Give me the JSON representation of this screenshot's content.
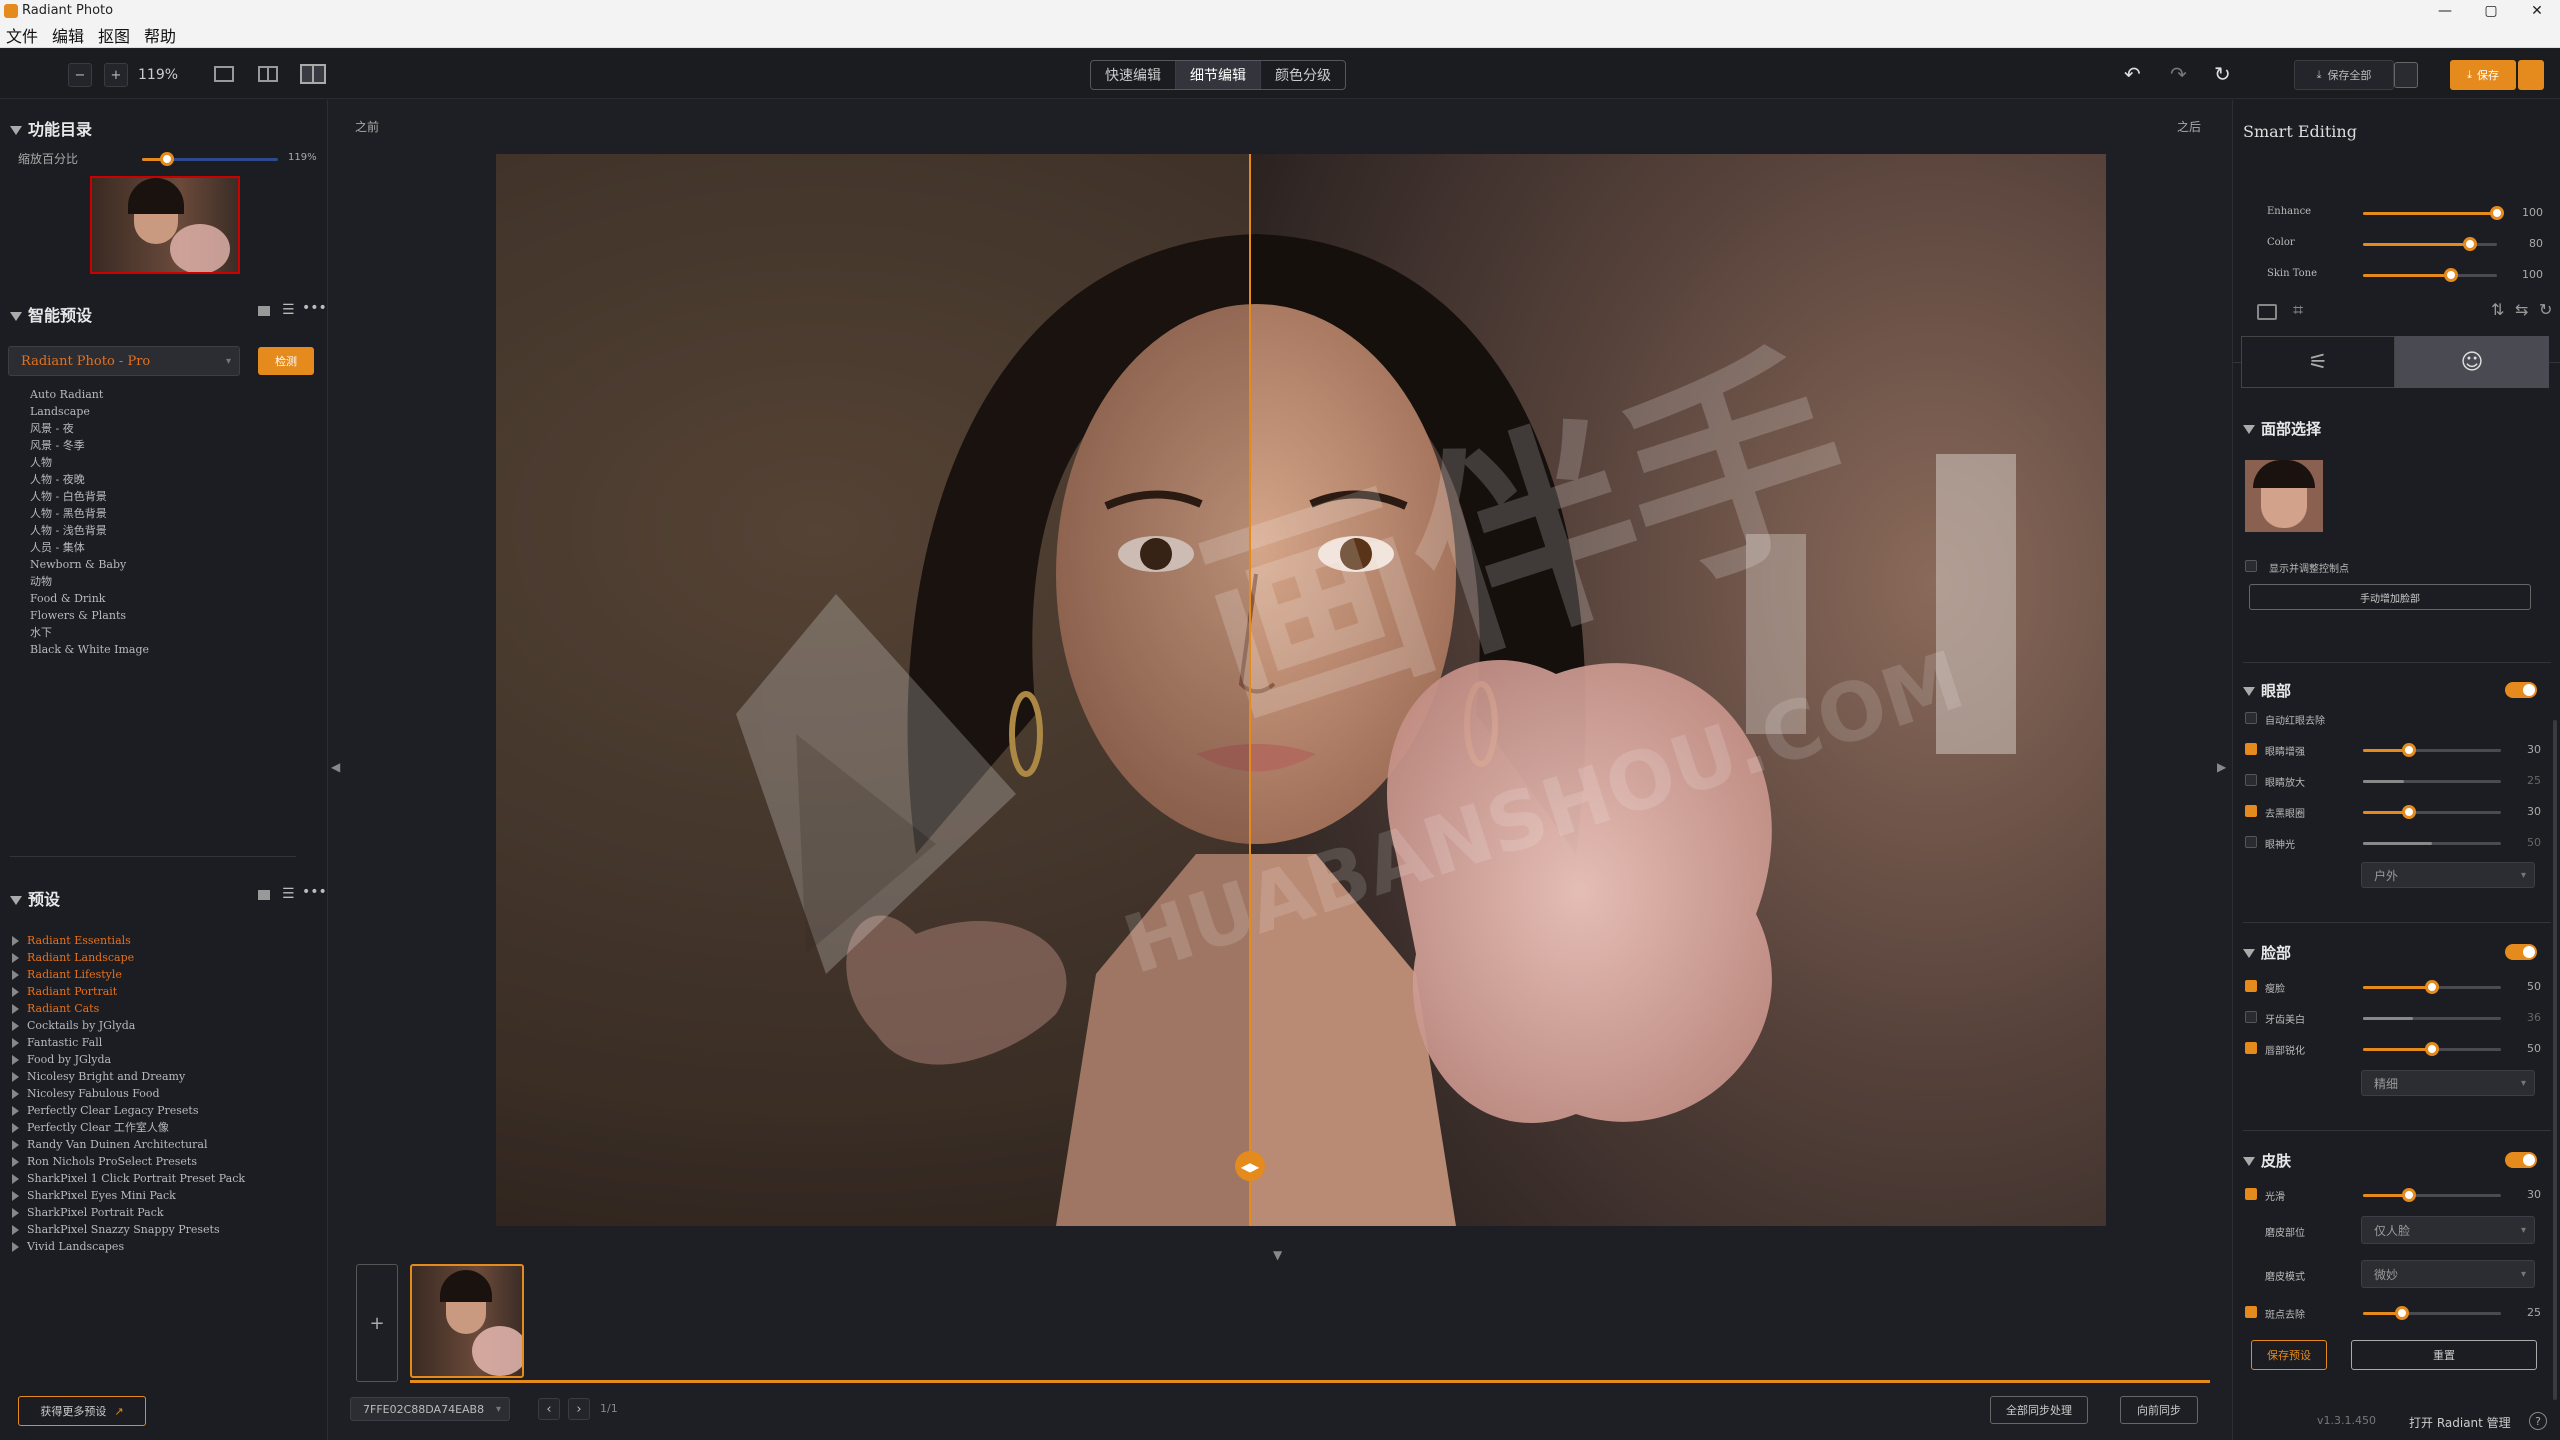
{
  "app": {
    "title": "Radiant Photo"
  },
  "menu": [
    "文件",
    "编辑",
    "抠图",
    "帮助"
  ],
  "toolbar": {
    "zoom": "119%",
    "modes": [
      "快速编辑",
      "细节编辑",
      "颜色分级"
    ],
    "save_all": "保存全部",
    "save": "保存"
  },
  "left": {
    "catalog_title": "功能目录",
    "zoom_label": "缩放百分比",
    "zoom_value": "119%",
    "smart_preset_title": "智能预设",
    "preset_select": "Radiant Photo - Pro",
    "detect_btn": "检测",
    "smart_presets": [
      "Auto Radiant",
      "Landscape",
      "风景 - 夜",
      "风景 - 冬季",
      "人物",
      "人物 - 夜晚",
      "人物 - 白色背景",
      "人物 - 黑色背景",
      "人物 - 浅色背景",
      "人员 - 集体",
      "Newborn & Baby",
      "动物",
      "Food & Drink",
      "Flowers & Plants",
      "水下",
      "Black & White Image"
    ],
    "presets_title": "预设",
    "presets": [
      {
        "name": "Radiant Essentials",
        "hl": true
      },
      {
        "name": "Radiant Landscape",
        "hl": true
      },
      {
        "name": "Radiant Lifestyle",
        "hl": true
      },
      {
        "name": "Radiant Portrait",
        "hl": true
      },
      {
        "name": "Radiant Cats",
        "hl": true
      },
      {
        "name": "Cocktails by JGlyda",
        "hl": false
      },
      {
        "name": "Fantastic Fall",
        "hl": false
      },
      {
        "name": "Food by JGlyda",
        "hl": false
      },
      {
        "name": "Nicolesy Bright and Dreamy",
        "hl": false
      },
      {
        "name": "Nicolesy Fabulous Food",
        "hl": false
      },
      {
        "name": "Perfectly Clear Legacy Presets",
        "hl": false
      },
      {
        "name": "Perfectly Clear 工作室人像",
        "hl": false
      },
      {
        "name": "Randy Van Duinen Architectural",
        "hl": false
      },
      {
        "name": "Ron Nichols ProSelect Presets",
        "hl": false
      },
      {
        "name": "SharkPixel 1 Click Portrait Preset Pack",
        "hl": false
      },
      {
        "name": "SharkPixel Eyes Mini Pack",
        "hl": false
      },
      {
        "name": "SharkPixel Portrait Pack",
        "hl": false
      },
      {
        "name": "SharkPixel Snazzy Snappy Presets",
        "hl": false
      },
      {
        "name": "Vivid Landscapes",
        "hl": false
      }
    ],
    "more_presets": "获得更多预设"
  },
  "center": {
    "before": "之前",
    "after": "之后",
    "watermark_main": "画伴手",
    "watermark_sub": "HUABANSHOU.COM",
    "file_id": "7FFE02C88DA74EAB8",
    "page": "1/1",
    "sync_all": "全部同步处理",
    "sync_fwd": "向前同步"
  },
  "right": {
    "smart_title": "Smart Editing",
    "smart_sliders": [
      {
        "label": "Enhance",
        "value": 100,
        "pos": 1.0
      },
      {
        "label": "Color",
        "value": 80,
        "pos": 0.8
      },
      {
        "label": "Skin Tone",
        "value": 100,
        "pos": 0.66
      }
    ],
    "face_title": "面部选择",
    "show_points": "显示并调整控制点",
    "add_face": "手动增加脸部",
    "eyes_title": "眼部",
    "eyes": [
      {
        "label": "自动红眼去除",
        "check": false,
        "slider": false
      },
      {
        "label": "眼睛增强",
        "check": true,
        "value": 30,
        "pos": 0.33
      },
      {
        "label": "眼睛放大",
        "check": false,
        "value": 25,
        "pos": 0.3,
        "dim": true
      },
      {
        "label": "去黑眼圈",
        "check": true,
        "value": 30,
        "pos": 0.33
      },
      {
        "label": "眼神光",
        "check": false,
        "value": 50,
        "pos": 0.5,
        "dim": true
      }
    ],
    "eyes_dd": "户外",
    "face_sec_title": "脸部",
    "face": [
      {
        "label": "瘦脸",
        "check": true,
        "value": 50,
        "pos": 0.5
      },
      {
        "label": "牙齿美白",
        "check": false,
        "value": 36,
        "pos": 0.36,
        "dim": true
      },
      {
        "label": "唇部锐化",
        "check": true,
        "value": 50,
        "pos": 0.5
      }
    ],
    "face_dd": "精细",
    "skin_title": "皮肤",
    "skin_smooth": {
      "label": "光滑",
      "value": 30,
      "pos": 0.33
    },
    "skin_area_label": "磨皮部位",
    "skin_area": "仅人脸",
    "skin_mode_label": "磨皮模式",
    "skin_mode": "微妙",
    "spot": {
      "label": "斑点去除",
      "value": 25,
      "pos": 0.28
    },
    "save_preset": "保存预设",
    "reset": "重置",
    "version": "v1.3.1.450",
    "manage": "打开 Radiant 管理"
  },
  "colors": {
    "accent": "#e58a1c",
    "bg": "#1e1f24"
  }
}
